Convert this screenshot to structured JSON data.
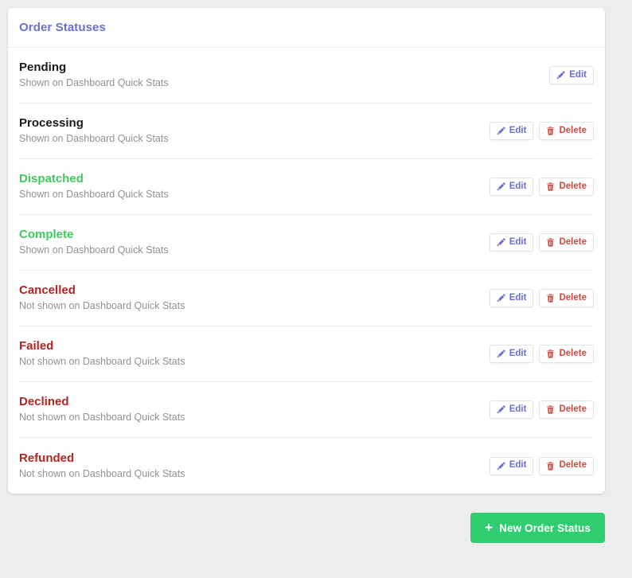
{
  "card": {
    "title": "Order Statuses"
  },
  "colors": {
    "accent_title": "#6b6fd1",
    "success": "#3dcc5c",
    "danger": "#b32424",
    "neutral": "#1b1b1d",
    "edit_text": "#6b6fd1",
    "delete_text": "#cf4a3f",
    "primary_button": "#2fcc70",
    "page_background": "#ededed"
  },
  "actions": {
    "edit_label": "Edit",
    "delete_label": "Delete",
    "edit_icon": "pencil-icon",
    "delete_icon": "trash-icon"
  },
  "footer": {
    "new_status_label": "New Order Status",
    "new_status_icon": "plus-icon"
  },
  "statuses": [
    {
      "name": "Pending",
      "visibility": "Shown on Dashboard Quick Stats",
      "tone": "neutral",
      "can_delete": false
    },
    {
      "name": "Processing",
      "visibility": "Shown on Dashboard Quick Stats",
      "tone": "neutral",
      "can_delete": true
    },
    {
      "name": "Dispatched",
      "visibility": "Shown on Dashboard Quick Stats",
      "tone": "success",
      "can_delete": true
    },
    {
      "name": "Complete",
      "visibility": "Shown on Dashboard Quick Stats",
      "tone": "success",
      "can_delete": true
    },
    {
      "name": "Cancelled",
      "visibility": "Not shown on Dashboard Quick Stats",
      "tone": "danger",
      "can_delete": true
    },
    {
      "name": "Failed",
      "visibility": "Not shown on Dashboard Quick Stats",
      "tone": "danger",
      "can_delete": true
    },
    {
      "name": "Declined",
      "visibility": "Not shown on Dashboard Quick Stats",
      "tone": "danger",
      "can_delete": true
    },
    {
      "name": "Refunded",
      "visibility": "Not shown on Dashboard Quick Stats",
      "tone": "danger",
      "can_delete": true
    }
  ]
}
